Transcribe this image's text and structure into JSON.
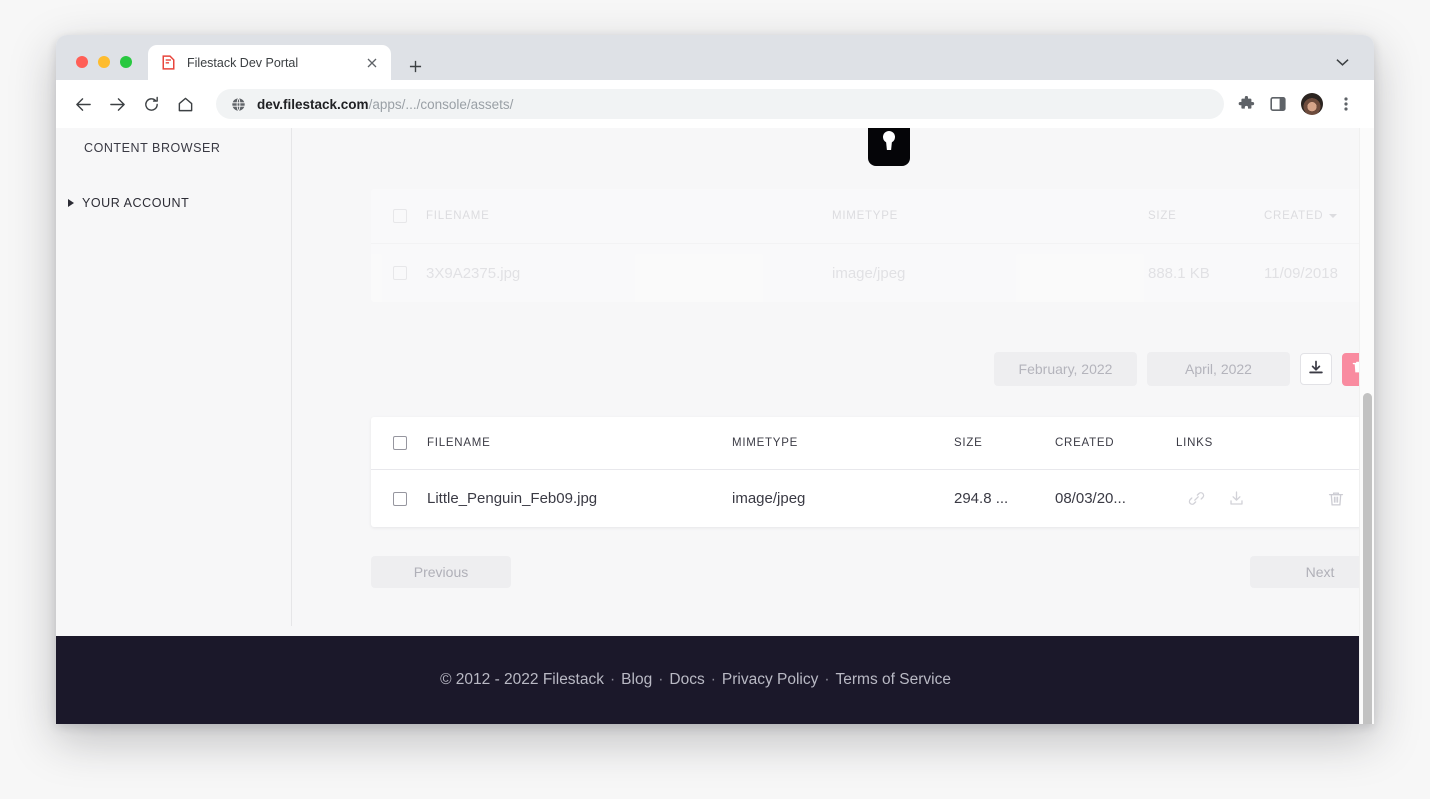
{
  "browser": {
    "tab": {
      "title": "Filestack Dev Portal",
      "favicon": "filestack-icon",
      "close": "close-icon"
    },
    "new_tab": "new-tab-icon",
    "tabstrip_chevron": "chevron-down-icon",
    "toolbar": {
      "back": "back-arrow-icon",
      "forward": "forward-arrow-icon",
      "reload": "reload-icon",
      "home": "home-icon",
      "site_icon": "globe-icon",
      "url_bold": "dev.filestack.com",
      "url_rest": "/apps/.../console/assets/",
      "extensions": "puzzle-piece-icon",
      "side_panel": "side-panel-icon",
      "profile": "avatar",
      "menu": "three-dot-menu-icon"
    }
  },
  "sidebar": {
    "heading": "CONTENT BROWSER",
    "items": [
      {
        "label": "YOUR ACCOUNT",
        "caret": "caret-right-icon"
      }
    ]
  },
  "ghost_table": {
    "lock_icon": "lock-icon",
    "headers": {
      "filename": "FILENAME",
      "mimetype": "MIMETYPE",
      "size": "SIZE",
      "created": "CREATED"
    },
    "sort_column": "CREATED",
    "sort_caret": "caret-down-icon",
    "rows": [
      {
        "filename": "3X9A2375.jpg",
        "mimetype": "image/jpeg",
        "size": "888.1 KB",
        "created": "11/09/2018"
      }
    ]
  },
  "actions": {
    "date_from": "February, 2022",
    "date_to": "April, 2022",
    "download_icon": "download-icon",
    "delete_icon": "trash-icon"
  },
  "asset_table": {
    "headers": {
      "filename": "FILENAME",
      "mimetype": "MIMETYPE",
      "size": "SIZE",
      "created": "CREATED",
      "links": "LINKS"
    },
    "rows": [
      {
        "filename": "Little_Penguin_Feb09.jpg",
        "mimetype": "image/jpeg",
        "size": "294.8 ...",
        "created": "08/03/20...",
        "link_icon": "link-chain-icon",
        "download_icon": "download-icon",
        "delete_icon": "trash-icon"
      }
    ]
  },
  "pagination": {
    "previous": "Previous",
    "next": "Next"
  },
  "footer": {
    "copyright": "© 2012 - 2022 Filestack",
    "sep": "·",
    "links": [
      "Blog",
      "Docs",
      "Privacy Policy",
      "Terms of Service"
    ]
  },
  "colors": {
    "accent_delete": "#f98ba0",
    "footer_bg": "#1b182a",
    "page_bg": "#f7f7f8"
  }
}
